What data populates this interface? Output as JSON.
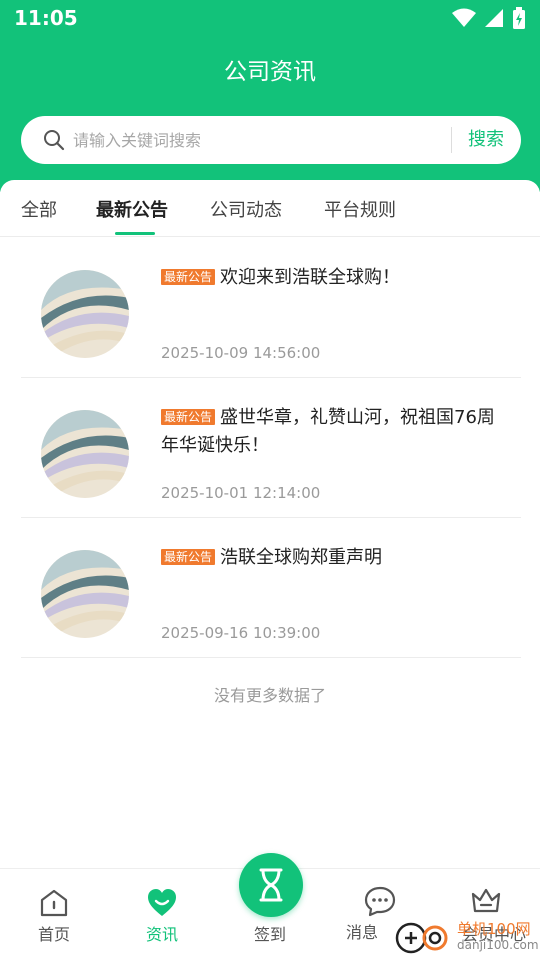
{
  "status_bar": {
    "time": "11:05"
  },
  "header": {
    "title": "公司资讯"
  },
  "search": {
    "placeholder": "请输入关键词搜索",
    "value": "",
    "button_label": "搜索"
  },
  "tabs": [
    {
      "label": "全部",
      "active": false
    },
    {
      "label": "最新公告",
      "active": true
    },
    {
      "label": "公司动态",
      "active": false
    },
    {
      "label": "平台规则",
      "active": false
    }
  ],
  "news": [
    {
      "badge": "最新公告",
      "title": "欢迎来到浩联全球购！",
      "date": "2025-10-09 14:56:00"
    },
    {
      "badge": "最新公告",
      "title": "盛世华章，礼赞山河，祝祖国76周年华诞快乐！",
      "date": "2025-10-01 12:14:00"
    },
    {
      "badge": "最新公告",
      "title": "浩联全球购郑重声明",
      "date": "2025-09-16 10:39:00"
    }
  ],
  "list_footer": "没有更多数据了",
  "bottom_nav": {
    "home": "首页",
    "news": "资讯",
    "checkin": "签到",
    "messages": "消息",
    "member": "会员中心"
  },
  "watermark": {
    "line1": "单机100网",
    "line2": "danji100.com"
  },
  "colors": {
    "brand": "#12c27a",
    "badge": "#f07a2e"
  }
}
